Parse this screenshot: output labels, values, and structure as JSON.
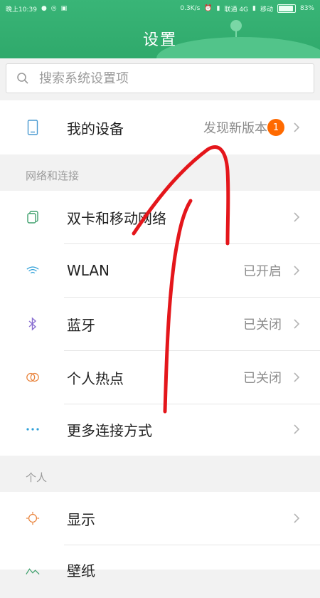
{
  "status_bar": {
    "time": "晚上10:39",
    "speed": "0.3K/s",
    "carrier1": "联通 4G",
    "carrier2": "移动",
    "battery": "83%"
  },
  "header": {
    "title": "设置"
  },
  "search": {
    "placeholder": "搜索系统设置项"
  },
  "device": {
    "label": "我的设备",
    "value": "发现新版本",
    "badge": "1"
  },
  "sections": {
    "network": "网络和连接",
    "personal": "个人"
  },
  "network_items": [
    {
      "label": "双卡和移动网络",
      "value": ""
    },
    {
      "label": "WLAN",
      "value": "已开启"
    },
    {
      "label": "蓝牙",
      "value": "已关闭"
    },
    {
      "label": "个人热点",
      "value": "已关闭"
    },
    {
      "label": "更多连接方式",
      "value": ""
    }
  ],
  "personal_items": [
    {
      "label": "显示"
    },
    {
      "label": "壁纸"
    }
  ],
  "colors": {
    "header_green": "#34b070",
    "badge_orange": "#ff6a00",
    "annotation_red": "#e4161b"
  },
  "icons": {
    "device": "phone-icon",
    "sim": "dual-sim-icon",
    "wlan": "wifi-icon",
    "bluetooth": "bluetooth-icon",
    "hotspot": "hotspot-icon",
    "more": "more-dots-icon",
    "display": "sun-icon",
    "wallpaper": "wallpaper-icon"
  }
}
